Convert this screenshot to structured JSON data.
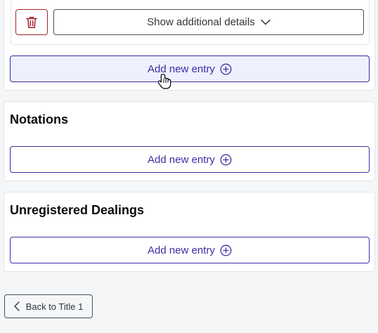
{
  "entry_panel": {
    "delete_icon": "trash-icon",
    "details_label": "Show additional details",
    "details_icon": "chevron-down-icon"
  },
  "top_section": {
    "add_label": "Add new entry",
    "add_icon": "plus-circle-icon",
    "add_state": "hovered"
  },
  "notations": {
    "title": "Notations",
    "add_label": "Add new entry"
  },
  "unregistered_dealings": {
    "title": "Unregistered Dealings",
    "add_label": "Add new entry"
  },
  "footer": {
    "back_label": "Back to Title 1",
    "back_icon": "chevron-left-icon"
  },
  "colors": {
    "accent": "#3b2fa3",
    "danger": "#a3242c",
    "hover_background": "#edf0fd",
    "page_background": "#f4f6f8"
  }
}
